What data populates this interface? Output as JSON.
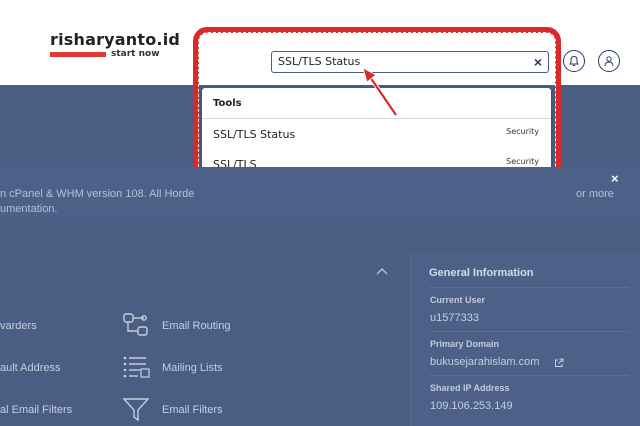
{
  "header": {
    "logo_text": "risharyanto.id",
    "logo_tagline": "start now",
    "bell_icon": "bell-icon",
    "user_icon": "user-icon"
  },
  "search": {
    "value": "SSL/TLS Status",
    "clear_label": "×"
  },
  "dropdown": {
    "heading": "Tools",
    "items": [
      {
        "label": "SSL/TLS Status",
        "category": "Security"
      },
      {
        "label": "SSL/TLS",
        "category": "Security"
      }
    ]
  },
  "notice": {
    "line1": "n cPanel & WHM version 108. All Horde",
    "line2": "umentation.",
    "more": "or more",
    "close_label": "×"
  },
  "main": {
    "left_items": [
      "varders",
      "ault Address",
      "al Email Filters"
    ],
    "right_items": [
      "Email Routing",
      "Mailing Lists",
      "Email Filters"
    ]
  },
  "sidebar": {
    "title": "General Information",
    "fields": [
      {
        "label": "Current User",
        "value": "u1577333"
      },
      {
        "label": "Primary Domain",
        "value": "bukusejarahislam.com"
      },
      {
        "label": "Shared IP Address",
        "value": "109.106.253.149"
      }
    ]
  },
  "colors": {
    "accent_red": "#d92a2a",
    "page_bg": "#4a5d82",
    "navy": "#2a3a66"
  }
}
